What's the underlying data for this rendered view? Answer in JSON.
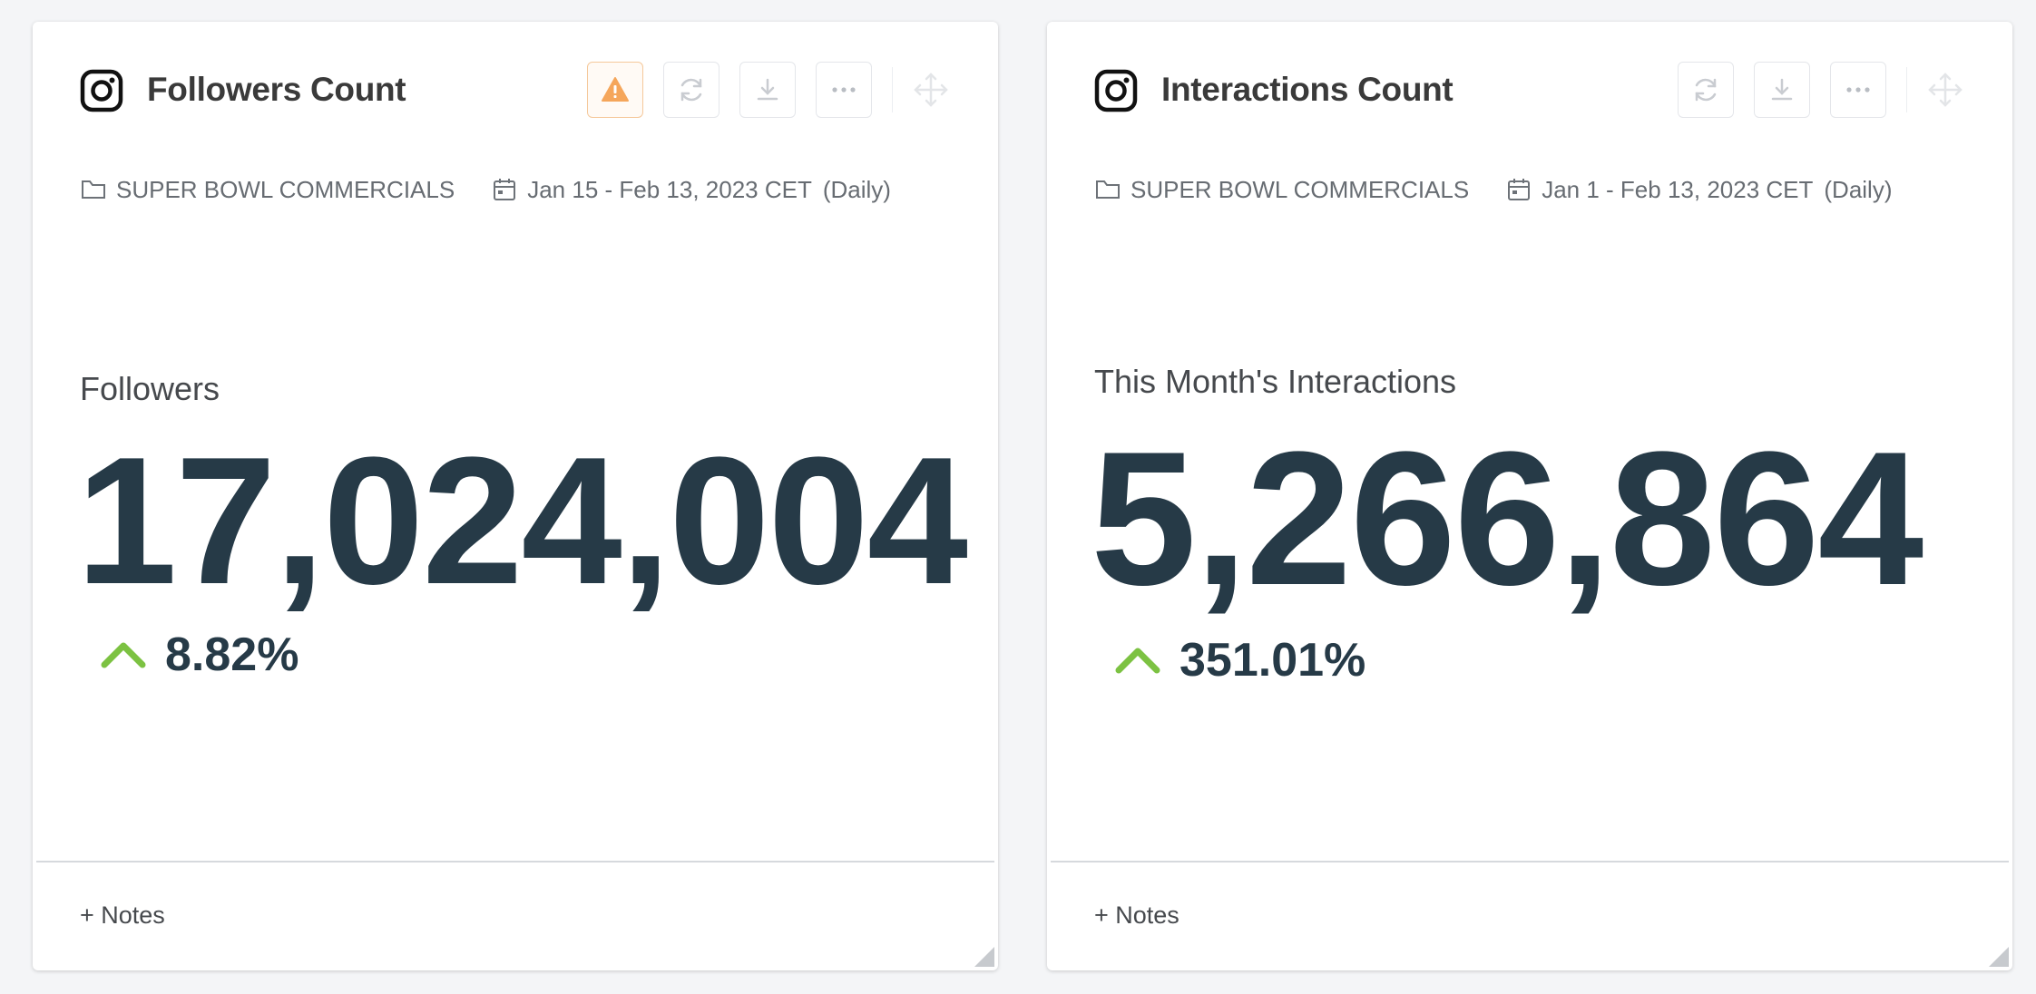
{
  "cards": [
    {
      "title": "Followers Count",
      "folder": "SUPER BOWL COMMERCIALS",
      "date_range": "Jan 15 - Feb 13, 2023 CET",
      "frequency": "(Daily)",
      "kpi_label": "Followers",
      "kpi_value": "17,024,004",
      "delta": "8.82%",
      "delta_direction": "up",
      "has_warning": true,
      "notes_label": "+ Notes"
    },
    {
      "title": "Interactions Count",
      "folder": "SUPER BOWL COMMERCIALS",
      "date_range": "Jan 1 - Feb 13, 2023 CET",
      "frequency": "(Daily)",
      "kpi_label": "This Month's Interactions",
      "kpi_value": "5,266,864",
      "delta": "351.01%",
      "delta_direction": "up",
      "has_warning": false,
      "notes_label": "+ Notes"
    }
  ],
  "icons": {
    "brand": "instagram-icon",
    "warning": "warning-icon",
    "refresh": "refresh-icon",
    "download": "download-icon",
    "more": "more-icon",
    "move": "move-icon",
    "folder": "folder-icon",
    "calendar": "calendar-icon",
    "trend": "chevron-up-icon"
  },
  "colors": {
    "value_text": "#263a47",
    "trend_up": "#7cc242",
    "warning": "#f5a65b",
    "background": "#f4f5f7"
  }
}
